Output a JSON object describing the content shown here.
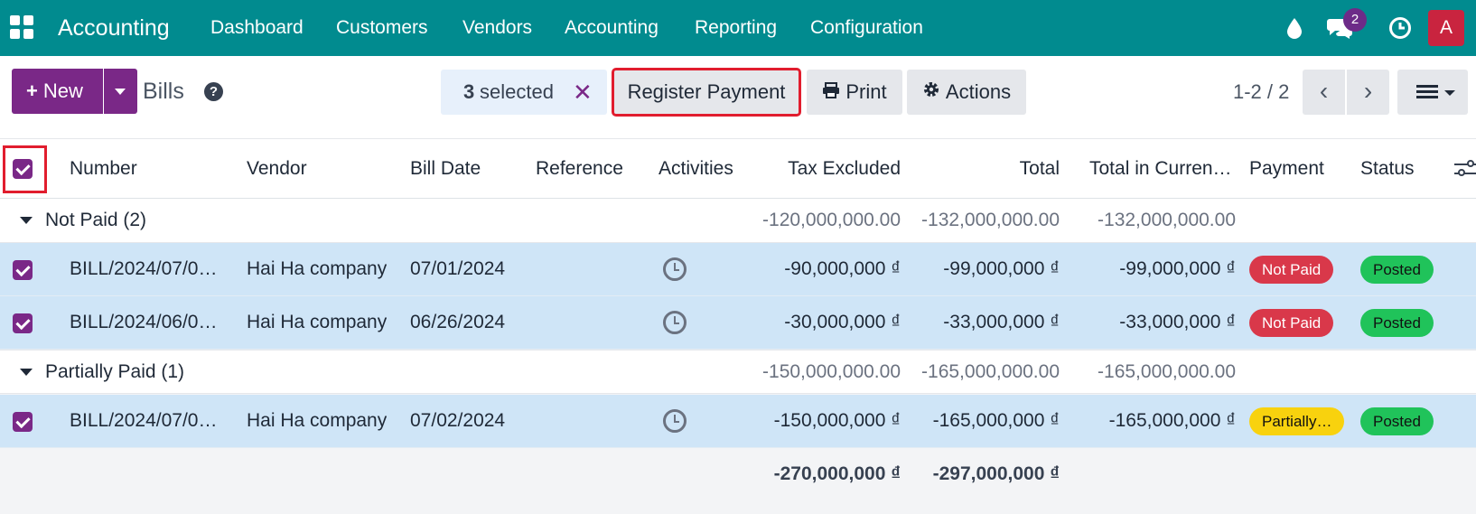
{
  "navbar": {
    "brand": "Accounting",
    "menu": [
      "Dashboard",
      "Customers",
      "Vendors",
      "Accounting",
      "Reporting",
      "Configuration"
    ],
    "messages_count": "2",
    "avatar_letter": "A"
  },
  "control_panel": {
    "new_label": "New",
    "breadcrumb": "Bills",
    "selected_count": "3",
    "selected_label": "selected",
    "register_payment": "Register Payment",
    "print": "Print",
    "actions": "Actions",
    "pager": "1-2 / 2"
  },
  "table": {
    "headers": {
      "number": "Number",
      "vendor": "Vendor",
      "bill_date": "Bill Date",
      "reference": "Reference",
      "activities": "Activities",
      "tax_excluded": "Tax Excluded",
      "total": "Total",
      "total_currency": "Total in Curren…",
      "payment": "Payment",
      "status": "Status"
    },
    "groups": [
      {
        "label": "Not Paid (2)",
        "tax_excluded": "-120,000,000.00",
        "total": "-132,000,000.00",
        "total_currency": "-132,000,000.00"
      },
      {
        "label": "Partially Paid (1)",
        "tax_excluded": "-150,000,000.00",
        "total": "-165,000,000.00",
        "total_currency": "-165,000,000.00"
      }
    ],
    "rows": [
      {
        "number": "BILL/2024/07/0…",
        "vendor": "Hai Ha company",
        "bill_date": "07/01/2024",
        "tax_excluded": "-90,000,000 ₫",
        "total": "-99,000,000 ₫",
        "total_currency": "-99,000,000 ₫",
        "payment": "Not Paid",
        "status": "Posted"
      },
      {
        "number": "BILL/2024/06/0…",
        "vendor": "Hai Ha company",
        "bill_date": "06/26/2024",
        "tax_excluded": "-30,000,000 ₫",
        "total": "-33,000,000 ₫",
        "total_currency": "-33,000,000 ₫",
        "payment": "Not Paid",
        "status": "Posted"
      },
      {
        "number": "BILL/2024/07/0…",
        "vendor": "Hai Ha company",
        "bill_date": "07/02/2024",
        "tax_excluded": "-150,000,000 ₫",
        "total": "-165,000,000 ₫",
        "total_currency": "-165,000,000 ₫",
        "payment": "Partially…",
        "status": "Posted"
      }
    ],
    "footer": {
      "tax_excluded": "-270,000,000 ₫",
      "total": "-297,000,000 ₫"
    }
  },
  "colors": {
    "navbar": "#018b8f",
    "primary": "#7a2887",
    "not_paid": "#d9384a",
    "posted": "#20c35a",
    "partial": "#f8d20e",
    "highlight_border": "#e11d2e"
  }
}
